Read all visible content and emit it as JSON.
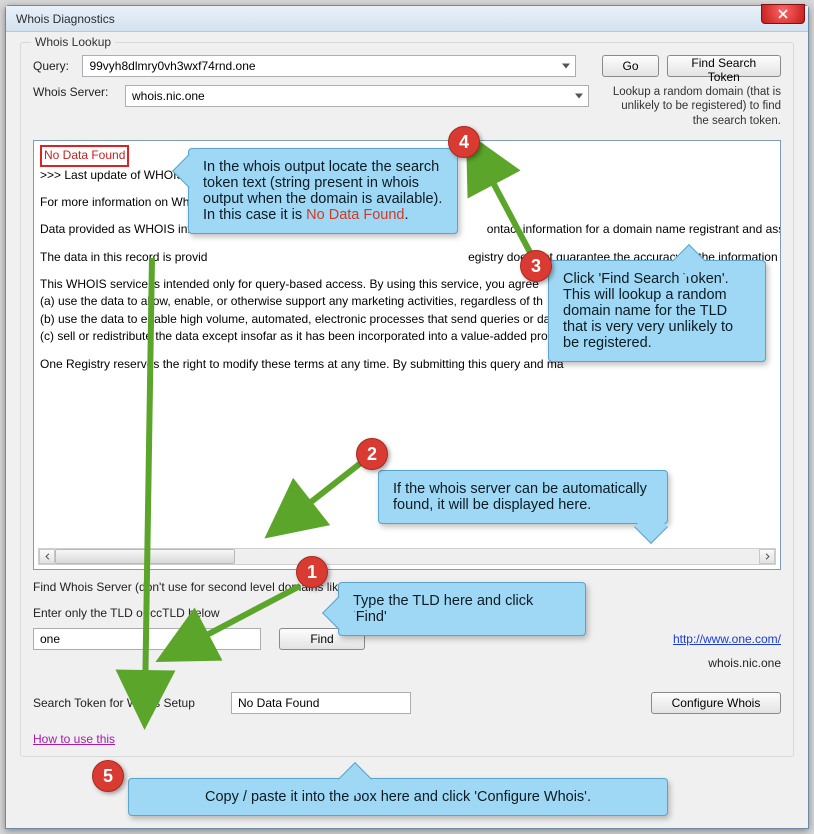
{
  "window": {
    "title": "Whois Diagnostics"
  },
  "lookup": {
    "group_title": "Whois Lookup",
    "query_label": "Query:",
    "query_value": "99vyh8dlmry0vh3wxf74rnd.one",
    "server_label": "Whois Server:",
    "server_value": "whois.nic.one",
    "go_label": "Go",
    "find_token_label": "Find Search Token",
    "hint": "Lookup a random domain (that is unlikely to be registered) to find the search token."
  },
  "output": {
    "nodata": "No Data Found",
    "l2": ">>> Last update of WHOIS",
    "l3": "For more information on Whois s",
    "l4a": "Data provided as WHOIS informa",
    "l4b": "ontact information for a domain name registrant and associated ac",
    "l5a": "The data in this record is provid",
    "l5b": "egistry does not guarantee the accuracy of the information prov",
    "l6": "This WHOIS service is intended only for query-based access. By using this service, you agree",
    "l7": "(a) use the data to allow, enable, or otherwise support any marketing activities, regardless of th",
    "l8": "(b) use the data to enable high volume, automated, electronic processes that send queries or da",
    "l9": "(c) sell or redistribute the data except insofar as it has been incorporated into a value-added pro",
    "l10": "One Registry reserves the right to modify these terms at any time. By submitting this query and ma"
  },
  "find": {
    "title": "Find Whois Server (don't use for second level domains like uk.com etc)",
    "enter_label": "Enter only the TLD or ccTLD below",
    "tld_value": "one",
    "find_label": "Find",
    "link_text": "http://www.one.com/",
    "server_text": "whois.nic.one"
  },
  "token": {
    "label": "Search Token for Whois Setup",
    "value": "No Data Found",
    "configure_label": "Configure Whois"
  },
  "help_link": "How to use this",
  "callouts": {
    "c4": "In the whois output locate the search token text (string present in whois output when the domain is available). In this case it is ",
    "c4_emph": "No Data Found",
    "c4_end": ".",
    "c3": "Click 'Find Search Token'. This will lookup a random domain name for the TLD that is very very unlikely to be registered.",
    "c2": "If the whois server can be automatically found, it will be displayed here.",
    "c1": "Type the TLD here and click 'Find'",
    "c5": "Copy / paste it into the box here and click 'Configure Whois'."
  }
}
